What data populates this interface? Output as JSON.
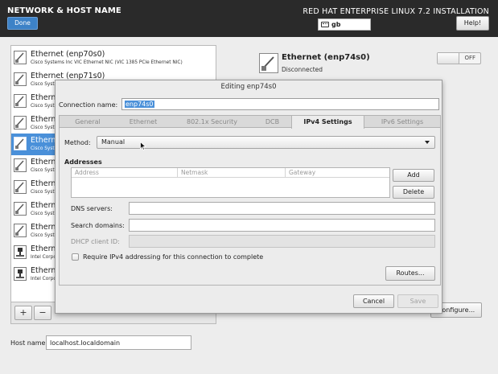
{
  "header": {
    "title": "NETWORK & HOST NAME",
    "done_label": "Done",
    "install_title": "RED HAT ENTERPRISE LINUX 7.2 INSTALLATION",
    "keyboard_layout": "gb",
    "help_label": "Help!"
  },
  "devices": [
    {
      "name": "Ethernet (enp70s0)",
      "desc": "Cisco Systems Inc VIC Ethernet NIC (VIC 1385 PCIe Ethernet NIC)",
      "icon": "ethernet-icon"
    },
    {
      "name": "Ethernet (enp71s0)",
      "desc": "Cisco Syste",
      "icon": "ethernet-icon"
    },
    {
      "name": "Etherne",
      "desc": "Cisco Syste",
      "icon": "ethernet-icon"
    },
    {
      "name": "Etherne",
      "desc": "Cisco Syste",
      "icon": "ethernet-icon"
    },
    {
      "name": "Etherne",
      "desc": "Cisco Syste",
      "icon": "ethernet-icon",
      "selected": true
    },
    {
      "name": "Etherne",
      "desc": "Cisco Syste",
      "icon": "ethernet-icon"
    },
    {
      "name": "Etherne",
      "desc": "Cisco Syste",
      "icon": "ethernet-icon"
    },
    {
      "name": "Etherne",
      "desc": "Cisco Syste",
      "icon": "ethernet-icon"
    },
    {
      "name": "Etherne",
      "desc": "Cisco Syste",
      "icon": "ethernet-icon"
    },
    {
      "name": "Etherne",
      "desc": "Intel Corpo",
      "icon": "ethernet-plug-icon"
    },
    {
      "name": "Etherne",
      "desc": "Intel Corpo",
      "icon": "ethernet-plug-icon"
    }
  ],
  "list_toolbar": {
    "add_label": "+",
    "remove_label": "−"
  },
  "device_detail": {
    "title": "Ethernet (enp74s0)",
    "status": "Disconnected",
    "toggle_label": "OFF",
    "toggle_on": false,
    "configure_label": "Configure..."
  },
  "hostname": {
    "label": "Host name:",
    "value": "localhost.localdomain"
  },
  "dialog": {
    "title": "Editing enp74s0",
    "connection_name_label": "Connection name:",
    "connection_name_value": "enp74s0",
    "tabs": [
      "General",
      "Ethernet",
      "802.1x Security",
      "DCB",
      "IPv4 Settings",
      "IPv6 Settings"
    ],
    "active_tab": "IPv4 Settings",
    "method_label": "Method:",
    "method_value": "Manual",
    "addresses_title": "Addresses",
    "address_columns": [
      "Address",
      "Netmask",
      "Gateway"
    ],
    "add_label": "Add",
    "delete_label": "Delete",
    "dns_label": "DNS servers:",
    "search_domains_label": "Search domains:",
    "dhcp_client_id_label": "DHCP client ID:",
    "require_ipv4_label": "Require IPv4 addressing for this connection to complete",
    "require_ipv4_checked": false,
    "routes_label": "Routes...",
    "cancel_label": "Cancel",
    "save_label": "Save"
  },
  "colors": {
    "header_bg": "#2a2a2a",
    "accent": "#4a90d9",
    "done_button": "#3d82c7"
  }
}
